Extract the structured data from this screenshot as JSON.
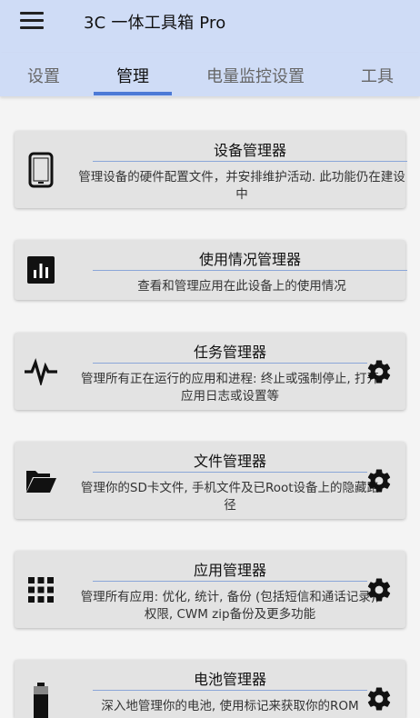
{
  "app": {
    "title": "3C 一体工具箱 Pro"
  },
  "tabs": [
    {
      "label": "设置",
      "active": false
    },
    {
      "label": "管理",
      "active": true
    },
    {
      "label": "电量监控设置",
      "active": false
    },
    {
      "label": "工具",
      "active": false
    }
  ],
  "colors": {
    "appbar": "#cfdcf6",
    "indicator": "#4d7ad6",
    "card": "#e3e3e3"
  },
  "cards": [
    {
      "title": "设备管理器",
      "description": "管理设备的硬件配置文件，并安排维护活动. 此功能仍在建设中",
      "icon": "phone-icon",
      "settings": false
    },
    {
      "title": "使用情况管理器",
      "description": "查看和管理应用在此设备上的使用情况",
      "icon": "bar-chart-icon",
      "settings": false
    },
    {
      "title": "任务管理器",
      "description": "管理所有正在运行的应用和进程: 终止或强制停止, 打开应用日志或设置等",
      "icon": "pulse-icon",
      "settings": true
    },
    {
      "title": "文件管理器",
      "description": "管理你的SD卡文件, 手机文件及已Root设备上的隐藏路径",
      "icon": "folder-open-icon",
      "settings": true
    },
    {
      "title": "应用管理器",
      "description": "管理所有应用: 优化, 统计, 备份 (包括短信和通话记录), 权限, CWM zip备份及更多功能",
      "icon": "grid-icon",
      "settings": true
    },
    {
      "title": "电池管理器",
      "description": "深入地管理你的电池, 使用标记来获取你的ROM",
      "icon": "battery-icon",
      "settings": true
    }
  ]
}
